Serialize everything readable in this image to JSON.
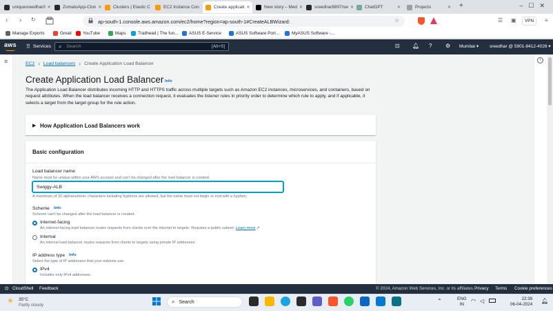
{
  "browser": {
    "tabs": [
      {
        "label": "uniquesreedhar/l",
        "color": "#24292f",
        "active": false
      },
      {
        "label": "ZomatoApp-Clon",
        "color": "#24292f",
        "active": false
      },
      {
        "label": "Clusters | Elastic C",
        "color": "#ff9900",
        "active": false
      },
      {
        "label": "EC2 Instance Con",
        "color": "#ff9900",
        "active": false
      },
      {
        "label": "Create applicati",
        "color": "#ff9900",
        "active": true
      },
      {
        "label": "New story – Med",
        "color": "#000000",
        "active": false
      },
      {
        "label": "sreedhar8897/sw",
        "color": "#24292f",
        "active": false
      },
      {
        "label": "ChatGPT",
        "color": "#74aa9c",
        "active": false
      },
      {
        "label": "Projects",
        "color": "#9aa0a6",
        "active": false
      }
    ],
    "url": "ap-south-1.console.aws.amazon.com/ec2/home?region=ap-south-1#CreateALBWizard:",
    "vpn_label": "VPN",
    "bookmarks": [
      {
        "label": "Manage Exports",
        "color": "#5f6368"
      },
      {
        "label": "Gmail",
        "color": "#ea4335"
      },
      {
        "label": "YouTube",
        "color": "#ff0000"
      },
      {
        "label": "Maps",
        "color": "#34a853"
      },
      {
        "label": "Trailhead | The fun...",
        "color": "#00a1e0"
      },
      {
        "label": "ASUS E-Service",
        "color": "#1a73e8"
      },
      {
        "label": "ASUS Software Port...",
        "color": "#1a73e8"
      },
      {
        "label": "MyASUS Software -...",
        "color": "#1a73e8"
      }
    ]
  },
  "aws": {
    "logo": "aws",
    "services_label": "Services",
    "search_placeholder": "Search",
    "search_shortcut": "[Alt+S]",
    "region": "Mumbai",
    "account": "sreedhar @ 5901-8412-4026"
  },
  "breadcrumb": {
    "root": "EC2",
    "parent": "Load balancers",
    "current": "Create Application Load Balancer"
  },
  "page": {
    "title": "Create Application Load Balancer",
    "info": "Info",
    "description": "The Application Load Balancer distributes incoming HTTP and HTTPS traffic across multiple targets such as Amazon EC2 instances, microservices, and containers, based on request attributes. When the load balancer receives a connection request, it evaluates the listener rules in priority order to determine which rule to apply, and if applicable, it selects a target from the target group for the rule action."
  },
  "how_section": {
    "title": "How Application Load Balancers work"
  },
  "basic": {
    "title": "Basic configuration",
    "name_label": "Load balancer name",
    "name_hint": "Name must be unique within your AWS account and can't be changed after the load balancer is created.",
    "name_value": "Swiggy-ALB",
    "name_constraint": "A maximum of 32 alphanumeric characters including hyphens are allowed, but the name must not begin or end with a hyphen.",
    "scheme_label": "Scheme",
    "scheme_info": "Info",
    "scheme_hint": "Scheme can't be changed after the load balancer is created.",
    "internet_label": "Internet-facing",
    "internet_desc": "An internet-facing load balancer routes requests from clients over the internet to targets. Requires a public subnet.",
    "learn_more": "Learn more",
    "internal_label": "Internal",
    "internal_desc": "An internal load balancer routes requests from clients to targets using private IP addresses.",
    "ip_label": "IP address type",
    "ip_info": "Info",
    "ip_hint": "Select the type of IP addresses that your subnets use.",
    "ipv4_label": "IPv4",
    "ipv4_desc": "Includes only IPv4 addresses."
  },
  "footer": {
    "cloudshell": "CloudShell",
    "feedback": "Feedback",
    "copyright": "© 2024, Amazon Web Services, Inc. or its affiliates.",
    "privacy": "Privacy",
    "terms": "Terms",
    "cookies": "Cookie preferences"
  },
  "taskbar": {
    "temp": "35°C",
    "weather": "Partly cloudy",
    "search": "Search",
    "lang": "ENG",
    "region": "IN",
    "time": "22:39",
    "date": "06-04-2024"
  }
}
